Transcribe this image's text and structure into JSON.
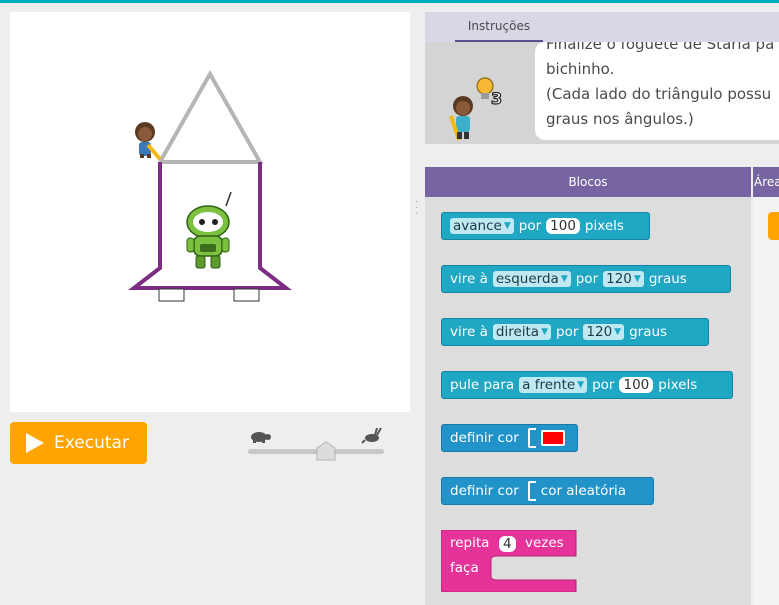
{
  "run_button": {
    "label": "Executar"
  },
  "instructions": {
    "tab": "Instruções",
    "line1": "Finalize o foguete de Starla pa",
    "line2": "bichinho.",
    "line3": "(Cada lado do triângulo possu",
    "line4": "graus nos ângulos.)",
    "hint_count": "3"
  },
  "toolbox": {
    "header": "Blocos",
    "area_header": "Área",
    "blocks": {
      "b1": {
        "dropdown": "avance",
        "por": "por",
        "value": "100",
        "unit": "pixels"
      },
      "b2": {
        "verb": "vire à",
        "dropdown": "esquerda",
        "por": "por",
        "value": "120",
        "unit": "graus"
      },
      "b3": {
        "verb": "vire à",
        "dropdown": "direita",
        "por": "por",
        "value": "120",
        "unit": "graus"
      },
      "b4": {
        "verb": "pule para",
        "dropdown": "a frente",
        "por": "por",
        "value": "100",
        "unit": "pixels"
      },
      "b5": {
        "label": "definir cor",
        "color": "#ff0000"
      },
      "b6": {
        "label": "definir cor",
        "value": "cor aleatória"
      },
      "b7": {
        "label": "repita",
        "value": "4",
        "suffix": "vezes",
        "do": "faça"
      }
    }
  },
  "colors": {
    "accent": "#ffa400",
    "purple_header": "#7665a0",
    "block_blue": "#1fa7c4",
    "repeat_pink": "#e6339a",
    "rocket_purple": "#7b2d82",
    "rocket_gray": "#b5b5b5"
  }
}
